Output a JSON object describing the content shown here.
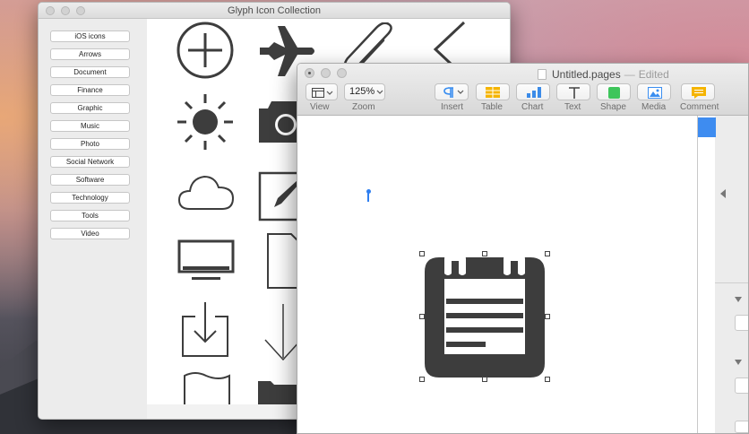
{
  "desktop": {
    "wallpaper": "mountain-sunset"
  },
  "glyph_window": {
    "title": "Glyph Icon Collection",
    "categories": [
      "iOS icons",
      "Arrows",
      "Document",
      "Finance",
      "Graphic",
      "Music",
      "Photo",
      "Social Network",
      "Software",
      "Technology",
      "Tools",
      "Video"
    ],
    "icons": [
      "plus-circle-icon",
      "airplane-icon",
      "paperclip-icon",
      "chevron-left-icon",
      "sun-icon",
      "camera-icon",
      "cloud-icon",
      "edit-icon",
      "monitor-icon",
      "document-icon",
      "download-icon",
      "arrow-down-icon",
      "flag-icon",
      "folder-icon"
    ]
  },
  "pages_window": {
    "title": "Untitled.pages",
    "separator": "—",
    "status": "Edited",
    "toolbar": {
      "view_label": "View",
      "zoom_value": "125%",
      "zoom_label": "Zoom",
      "insert_label": "Insert",
      "table_label": "Table",
      "chart_label": "Chart",
      "text_label": "Text",
      "shape_label": "Shape",
      "media_label": "Media",
      "comment_label": "Comment"
    },
    "colors": {
      "accent": "#3e8cf0",
      "table": "#f5b400",
      "chart": "#3b8be8",
      "shape": "#3ec55b",
      "media": "#3a8ef0",
      "comment": "#f5b400",
      "glyph": "#3d3d3d"
    },
    "canvas": {
      "selected_object": "notepad-glyph-icon"
    }
  }
}
